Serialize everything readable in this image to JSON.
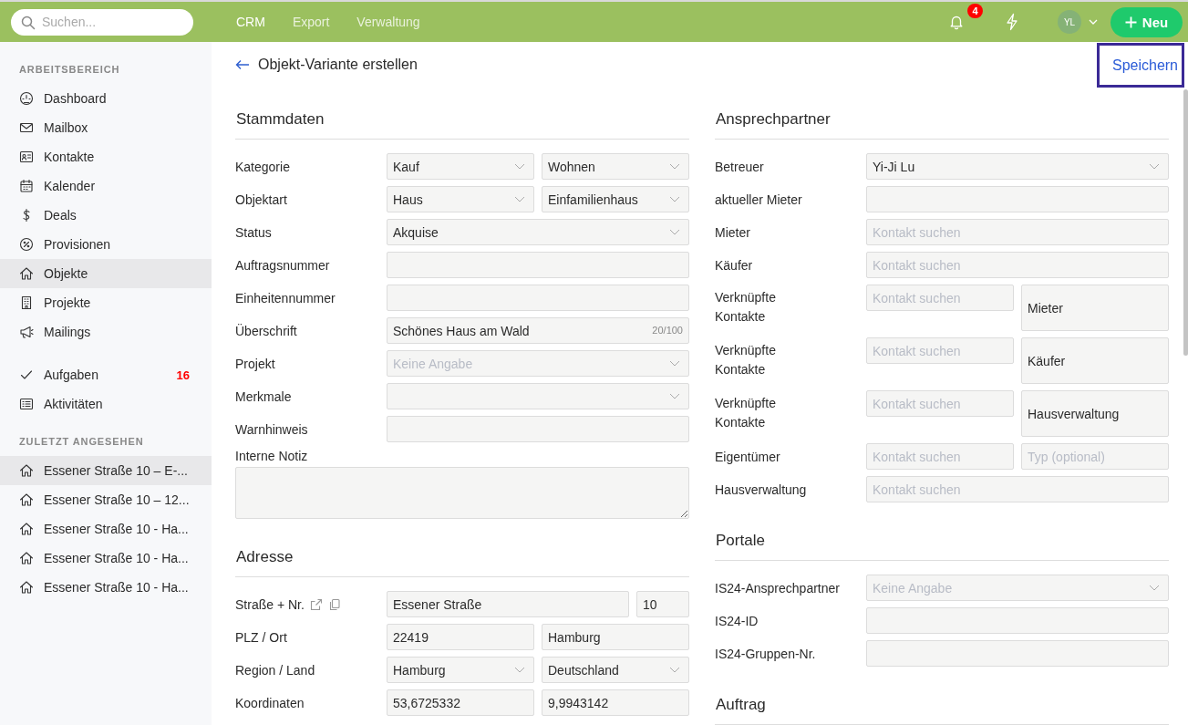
{
  "topbar": {
    "search": {
      "placeholder": "Suchen..."
    },
    "nav": [
      {
        "label": "CRM",
        "selected": true
      },
      {
        "label": "Export",
        "selected": false
      },
      {
        "label": "Verwaltung",
        "selected": false
      }
    ],
    "notifications": "4",
    "avatar": "YL",
    "new_button": "Neu"
  },
  "sidebar": {
    "sections": [
      {
        "title": "ARBEITSBEREICH",
        "items": [
          {
            "label": "Dashboard",
            "selected": false
          },
          {
            "label": "Mailbox",
            "selected": false
          },
          {
            "label": "Kontakte",
            "selected": false
          },
          {
            "label": "Kalender",
            "selected": false
          },
          {
            "label": "Deals",
            "selected": false
          },
          {
            "label": "Provisionen",
            "selected": false
          },
          {
            "label": "Objekte",
            "selected": true
          },
          {
            "label": "Projekte",
            "selected": false
          },
          {
            "label": "Mailings",
            "selected": false
          }
        ]
      },
      {
        "items": [
          {
            "label": "Aufgaben",
            "selected": false,
            "badge": "16"
          },
          {
            "label": "Aktivitäten",
            "selected": false
          }
        ]
      },
      {
        "title": "ZULETZT ANGESEHEN",
        "items": [
          {
            "label": "Essener Straße 10 – E-...",
            "selected": true
          },
          {
            "label": "Essener Straße 10 – 12...",
            "selected": false
          },
          {
            "label": "Essener Straße 10 - Ha...",
            "selected": false
          },
          {
            "label": "Essener Straße 10 - Ha...",
            "selected": false
          },
          {
            "label": "Essener Straße 10 - Ha...",
            "selected": false
          }
        ]
      }
    ]
  },
  "page": {
    "title": "Objekt-Variante erstellen",
    "save_button": {
      "label": "Speichern",
      "focused": true
    }
  },
  "columns": [
    {
      "sections": [
        {
          "title": "Stammdaten",
          "rows": [
            {
              "label": "Kategorie",
              "fields": [
                {
                  "kind": "select",
                  "value": "Kauf"
                },
                {
                  "kind": "select",
                  "value": "Wohnen"
                }
              ]
            },
            {
              "label": "Objektart",
              "fields": [
                {
                  "kind": "select",
                  "value": "Haus"
                },
                {
                  "kind": "select",
                  "value": "Einfamilienhaus"
                }
              ]
            },
            {
              "label": "Status",
              "fields": [
                {
                  "kind": "select",
                  "value": "Akquise"
                }
              ]
            },
            {
              "label": "Auftragsnummer",
              "fields": [
                {
                  "kind": "input"
                }
              ]
            },
            {
              "label": "Einheitennummer",
              "fields": [
                {
                  "kind": "input"
                }
              ]
            },
            {
              "label": "Überschrift",
              "fields": [
                {
                  "kind": "input",
                  "value": "Schönes Haus am Wald",
                  "counter": "20/100"
                }
              ]
            },
            {
              "label": "Projekt",
              "fields": [
                {
                  "kind": "select",
                  "placeholder": "Keine Angabe"
                }
              ]
            },
            {
              "label": "Merkmale",
              "fields": [
                {
                  "kind": "select"
                }
              ]
            },
            {
              "label": "Warnhinweis",
              "fields": [
                {
                  "kind": "input"
                }
              ]
            },
            {
              "label": "Interne Notiz",
              "kind": "stacked",
              "fields": [
                {
                  "kind": "textarea"
                }
              ]
            }
          ]
        },
        {
          "title": "Adresse",
          "rows": [
            {
              "label": "Straße + Nr.",
              "actions": true,
              "fields": [
                {
                  "kind": "input",
                  "value": "Essener Straße"
                },
                {
                  "kind": "short",
                  "value": "10"
                }
              ]
            },
            {
              "label": "PLZ / Ort",
              "fields": [
                {
                  "kind": "input",
                  "value": "22419"
                },
                {
                  "kind": "input",
                  "value": "Hamburg"
                }
              ]
            },
            {
              "label": "Region / Land",
              "fields": [
                {
                  "kind": "select",
                  "value": "Hamburg"
                },
                {
                  "kind": "select",
                  "value": "Deutschland"
                }
              ]
            },
            {
              "label": "Koordinaten",
              "fields": [
                {
                  "kind": "input",
                  "value": "53,6725332"
                },
                {
                  "kind": "input",
                  "value": "9,9943142"
                }
              ]
            }
          ]
        }
      ]
    },
    {
      "sections": [
        {
          "title": "Ansprechpartner",
          "rows": [
            {
              "label": "Betreuer",
              "fields": [
                {
                  "kind": "select",
                  "value": "Yi-Ji Lu"
                }
              ]
            },
            {
              "label": "aktueller Mieter",
              "fields": [
                {
                  "kind": "input"
                }
              ]
            },
            {
              "label": "Mieter",
              "fields": [
                {
                  "kind": "input",
                  "placeholder": "Kontakt suchen"
                }
              ]
            },
            {
              "label": "Käufer",
              "fields": [
                {
                  "kind": "input",
                  "placeholder": "Kontakt suchen"
                }
              ]
            },
            {
              "label": "Verknüpfte Kontakte",
              "kind": "linked",
              "fields": [
                {
                  "kind": "input",
                  "placeholder": "Kontakt suchen"
                },
                {
                  "kind": "typebox",
                  "value": "Mieter"
                }
              ]
            },
            {
              "label": "Verknüpfte Kontakte",
              "kind": "linked",
              "fields": [
                {
                  "kind": "input",
                  "placeholder": "Kontakt suchen"
                },
                {
                  "kind": "typebox",
                  "value": "Käufer"
                }
              ]
            },
            {
              "label": "Verknüpfte Kontakte",
              "kind": "linked",
              "fields": [
                {
                  "kind": "input",
                  "placeholder": "Kontakt suchen"
                },
                {
                  "kind": "typebox",
                  "value": "Hausverwaltung"
                }
              ]
            },
            {
              "label": "Eigentümer",
              "fields": [
                {
                  "kind": "input",
                  "placeholder": "Kontakt suchen"
                },
                {
                  "kind": "input",
                  "placeholder": "Typ (optional)"
                }
              ]
            },
            {
              "label": "Hausverwaltung",
              "fields": [
                {
                  "kind": "input",
                  "placeholder": "Kontakt suchen"
                }
              ]
            }
          ]
        },
        {
          "title": "Portale",
          "rows": [
            {
              "label": "IS24-Ansprechpartner",
              "fields": [
                {
                  "kind": "select",
                  "placeholder": "Keine Angabe"
                }
              ]
            },
            {
              "label": "IS24-ID",
              "fields": [
                {
                  "kind": "input"
                }
              ]
            },
            {
              "label": "IS24-Gruppen-Nr.",
              "fields": [
                {
                  "kind": "input"
                }
              ]
            }
          ]
        },
        {
          "title": "Auftrag"
        }
      ]
    }
  ]
}
